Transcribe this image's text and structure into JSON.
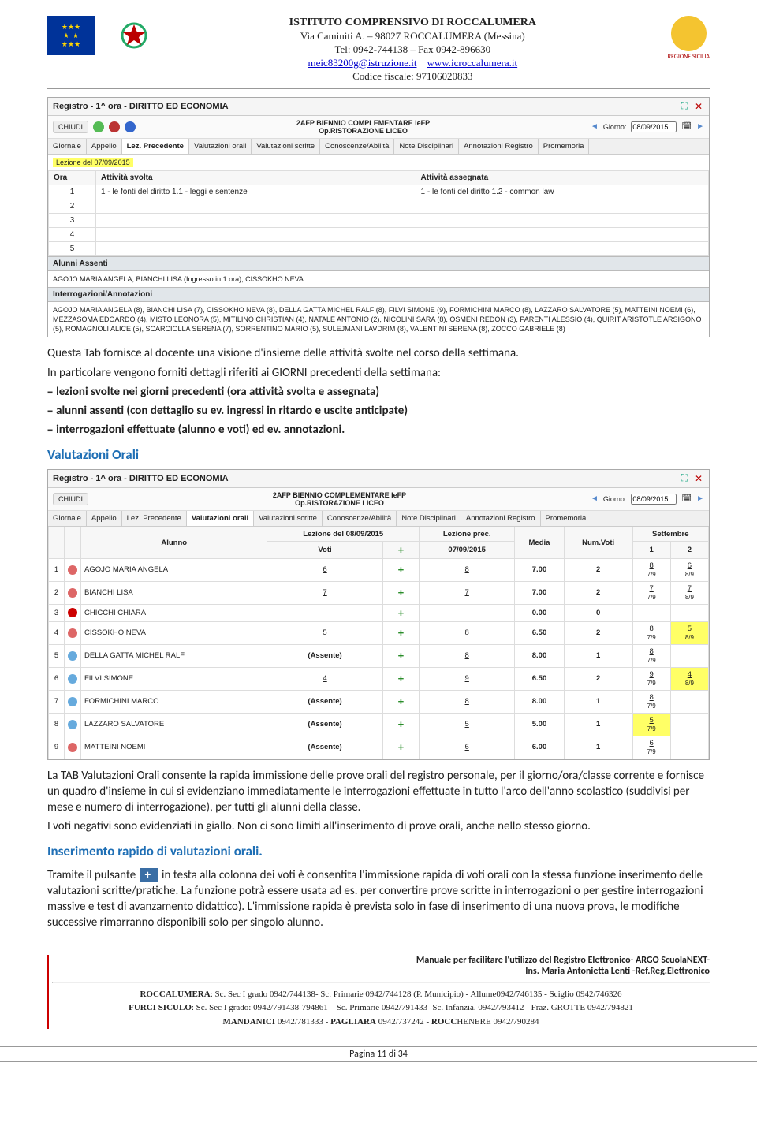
{
  "header": {
    "line1": "ISTITUTO COMPRENSIVO DI ROCCALUMERA",
    "line2": "Via Caminiti A. – 98027 ROCCALUMERA (Messina)",
    "line3": "Tel: 0942-744138 – Fax 0942-896630",
    "email": "meic83200g@istruzione.it",
    "web": "www.icroccalumera.it",
    "cf": "Codice fiscale: 97106020833",
    "region_label": "REGIONE SICILIA"
  },
  "screenshot1": {
    "title": "Registro - 1^ ora - DIRITTO ED ECONOMIA",
    "chiudi": "CHIUDI",
    "subtitle": "2AFP BIENNIO COMPLEMENTARE IeFP\nOp.RISTORAZIONE LICEO",
    "giorno_label": "Giorno:",
    "giorno_value": "08/09/2015",
    "tabs": [
      "Giornale",
      "Appello",
      "Lez. Precedente",
      "Valutazioni orali",
      "Valutazioni scritte",
      "Conoscenze/Abilità",
      "Note Disciplinari",
      "Annotazioni Registro",
      "Promemoria"
    ],
    "active_tab": 2,
    "lesson_badge": "Lezione del 07/09/2015",
    "cols": {
      "ora": "Ora",
      "svolta": "Attività svolta",
      "assegnata": "Attività assegnata"
    },
    "rows": [
      {
        "ora": "1",
        "svolta": "1 - le fonti del diritto 1.1 - leggi e sentenze",
        "assegnata": "1 - le fonti del diritto 1.2 - common law"
      },
      {
        "ora": "2",
        "svolta": "",
        "assegnata": ""
      },
      {
        "ora": "3",
        "svolta": "",
        "assegnata": ""
      },
      {
        "ora": "4",
        "svolta": "",
        "assegnata": ""
      },
      {
        "ora": "5",
        "svolta": "",
        "assegnata": ""
      }
    ],
    "assenti_title": "Alunni Assenti",
    "assenti_body": "AGOJO MARIA ANGELA, BIANCHI LISA (Ingresso in 1 ora), CISSOKHO NEVA",
    "interrog_title": "Interrogazioni/Annotazioni",
    "interrog_body": "AGOJO MARIA ANGELA (8), BIANCHI LISA (7), CISSOKHO NEVA (8), DELLA GATTA MICHEL RALF (8), FILVI SIMONE (9), FORMICHINI MARCO (8), LAZZARO SALVATORE (5), MATTEINI NOEMI (6), MEZZASOMA EDOARDO (4), MISTO LEONORA (5), MITILINO CHRISTIAN (4), NATALE ANTONIO (2), NICOLINI SARA (8), OSMENI REDON (3), PARENTI ALESSIO (4), QUIRIT ARISTOTLE ARSIGONO (5), ROMAGNOLI ALICE (5), SCARCIOLLA SERENA (7), SORRENTINO MARIO (5), SULEJMANI LAVDRIM (8), VALENTINI SERENA (8), ZOCCO GABRIELE (8)"
  },
  "text1": {
    "p1": "Questa Tab fornisce al docente una visione d'insieme delle attività svolte nel corso della settimana.",
    "p2": "In particolare vengono forniti dettagli riferiti ai GIORNI precedenti della settimana:",
    "b1": "lezioni svolte nei giorni precedenti (ora attività svolta e assegnata)",
    "b2": "alunni assenti (con dettaglio su ev. ingressi in ritardo e uscite anticipate)",
    "b3": "interrogazioni effettuate (alunno e voti) ed ev. annotazioni."
  },
  "h_val_orali": "Valutazioni Orali",
  "screenshot2": {
    "title": "Registro - 1^ ora - DIRITTO ED ECONOMIA",
    "chiudi": "CHIUDI",
    "subtitle": "2AFP BIENNIO COMPLEMENTARE IeFP\nOp.RISTORAZIONE LICEO",
    "giorno_label": "Giorno:",
    "giorno_value": "08/09/2015",
    "tabs": [
      "Giornale",
      "Appello",
      "Lez. Precedente",
      "Valutazioni orali",
      "Valutazioni scritte",
      "Conoscenze/Abilità",
      "Note Disciplinari",
      "Annotazioni Registro",
      "Promemoria"
    ],
    "active_tab": 3,
    "cols": {
      "alunno": "Alunno",
      "lez_today": "Lezione del 08/09/2015",
      "voti": "Voti",
      "lez_prev": "Lezione prec.",
      "prev_date": "07/09/2015",
      "media": "Media",
      "numvoti": "Num.Voti",
      "month": "Settembre",
      "m1": "1",
      "m2": "2"
    },
    "rows": [
      {
        "n": "1",
        "g": "f",
        "name": "AGOJO MARIA ANGELA",
        "voto": "6",
        "prev": "8",
        "media": "7.00",
        "num": "2",
        "c1": {
          "t": "8",
          "b": "7/9"
        },
        "c2": {
          "t": "6",
          "b": "8/9"
        }
      },
      {
        "n": "2",
        "g": "f",
        "name": "BIANCHI LISA",
        "voto": "7",
        "prev": "7",
        "media": "7.00",
        "num": "2",
        "c1": {
          "t": "7",
          "b": "7/9"
        },
        "c2": {
          "t": "7",
          "b": "8/9"
        }
      },
      {
        "n": "3",
        "g": "red",
        "name": "CHICCHI CHIARA",
        "voto": "",
        "prev": "",
        "media": "0.00",
        "num": "0",
        "c1": null,
        "c2": null
      },
      {
        "n": "4",
        "g": "f",
        "name": "CISSOKHO NEVA",
        "voto": "5",
        "prev": "8",
        "media": "6.50",
        "num": "2",
        "c1": {
          "t": "8",
          "b": "7/9"
        },
        "c2": {
          "t": "5",
          "b": "8/9",
          "hl": true
        }
      },
      {
        "n": "5",
        "g": "m",
        "name": "DELLA GATTA MICHEL RALF",
        "voto": "(Assente)",
        "prev": "8",
        "media": "8.00",
        "num": "1",
        "c1": {
          "t": "8",
          "b": "7/9"
        },
        "c2": null
      },
      {
        "n": "6",
        "g": "m",
        "name": "FILVI SIMONE",
        "voto": "4",
        "prev": "9",
        "media": "6.50",
        "num": "2",
        "c1": {
          "t": "9",
          "b": "7/9"
        },
        "c2": {
          "t": "4",
          "b": "8/9",
          "hl": true
        }
      },
      {
        "n": "7",
        "g": "m",
        "name": "FORMICHINI MARCO",
        "voto": "(Assente)",
        "prev": "8",
        "media": "8.00",
        "num": "1",
        "c1": {
          "t": "8",
          "b": "7/9"
        },
        "c2": null
      },
      {
        "n": "8",
        "g": "m",
        "name": "LAZZARO SALVATORE",
        "voto": "(Assente)",
        "prev": "5",
        "media": "5.00",
        "num": "1",
        "c1": {
          "t": "5",
          "b": "7/9",
          "hl": true
        },
        "c2": null
      },
      {
        "n": "9",
        "g": "f",
        "name": "MATTEINI NOEMI",
        "voto": "(Assente)",
        "prev": "6",
        "media": "6.00",
        "num": "1",
        "c1": {
          "t": "6",
          "b": "7/9"
        },
        "c2": null
      }
    ]
  },
  "text2": {
    "p1": "La TAB Valutazioni Orali consente la rapida immissione delle prove orali del registro personale, per il giorno/ora/classe corrente e fornisce un quadro d'insieme in cui si evidenziano immediatamente le interrogazioni effettuate in tutto l'arco dell'anno scolastico (suddivisi per mese e numero di interrogazione), per tutti gli alunni della classe.",
    "p2": "I voti negativi sono evidenziati in giallo. Non ci sono limiti all'inserimento di prove orali, anche nello stesso giorno."
  },
  "h_ins_rapido": "Inserimento rapido di valutazioni orali.",
  "text3": {
    "p1a": "Tramite il pulsante ",
    "p1b": " in testa alla colonna dei voti è consentita l'immissione rapida di voti orali con la stessa funzione inserimento delle valutazioni scritte/pratiche. La funzione potrà essere usata ad es. per convertire prove scritte in interrogazioni o per gestire interrogazioni massive e test di avanzamento didattico). L'immissione rapida è prevista solo in fase di inserimento di una nuova prova, le modifiche successive rimarranno disponibili solo per singolo alunno."
  },
  "footer": {
    "manual1": "Manuale  per facilitare l'utilizzo del Registro Elettronico- ARGO ScuolaNEXT-",
    "manual2": "Ins. Maria Antonietta Lenti -Ref.Reg.Elettronico",
    "l1": "ROCCALUMERA: Sc. Sec I grado  0942/744138- Sc. Primarie 0942/744128 (P. Municipio) - Allume0942/746135 - Sciglio 0942/746326",
    "l2": "FURCI SICULO: Sc. Sec I grado: 0942/791438-794861 – Sc. Primarie 0942/791433-   Sc. Infanzia. 0942/793412 - Fraz. GROTTE  0942/794821",
    "l3": "MANDANICI  0942/781333 - PAGLIARA  0942/737242 - ROCCHENERE 0942/790284",
    "page": "Pagina 11 di 34"
  }
}
